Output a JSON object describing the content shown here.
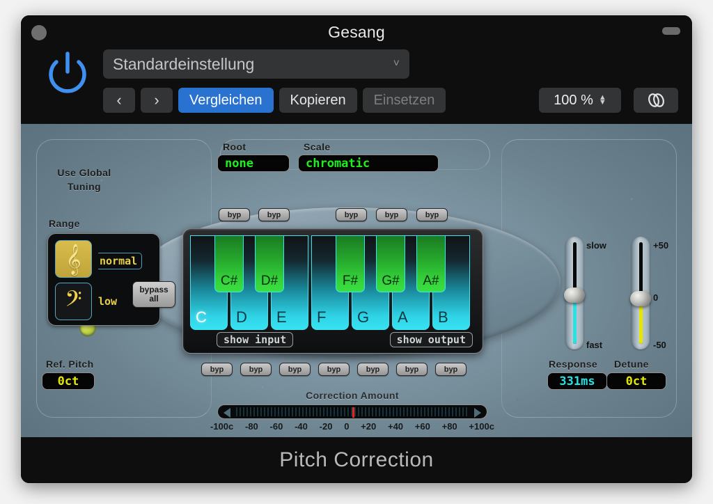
{
  "window": {
    "title": "Gesang",
    "footer_title": "Pitch Correction"
  },
  "header": {
    "power_icon": "power-icon",
    "preset": {
      "value": "Standardeinstellung",
      "chevron": "˅"
    },
    "prev_label": "‹",
    "next_label": "›",
    "compare_label": "Vergleichen",
    "copy_label": "Kopieren",
    "paste_label": "Einsetzen",
    "zoom_value": "100 %",
    "link_icon": "link-icon"
  },
  "left_panel": {
    "global_tuning_label_line1": "Use Global",
    "global_tuning_label_line2": "Tuning",
    "global_tuning_led_color": "#c5d94a",
    "range_label": "Range",
    "range_options": [
      {
        "glyph": "𝄞",
        "label": "normal",
        "selected": true
      },
      {
        "glyph": "𝄢",
        "label": "low",
        "selected": false
      }
    ],
    "ref_pitch_label": "Ref. Pitch",
    "ref_pitch_value": "0ct"
  },
  "scale_section": {
    "root_label": "Root",
    "root_value": "none",
    "scale_label": "Scale",
    "scale_value": "chromatic"
  },
  "bypass_all_label_line1": "bypass",
  "bypass_all_label_line2": "all",
  "byp_label": "byp",
  "byp_top": [
    "byp",
    "byp",
    "byp",
    "byp",
    "byp"
  ],
  "byp_bottom": [
    "byp",
    "byp",
    "byp",
    "byp",
    "byp",
    "byp",
    "byp"
  ],
  "keyboard": {
    "white_keys": [
      {
        "label": "C",
        "active": true
      },
      {
        "label": "D",
        "active": false
      },
      {
        "label": "E",
        "active": false
      },
      {
        "label": "F",
        "active": false
      },
      {
        "label": "G",
        "active": false
      },
      {
        "label": "A",
        "active": false
      },
      {
        "label": "B",
        "active": false
      }
    ],
    "black_keys": [
      {
        "label": "C#"
      },
      {
        "label": "D#"
      },
      {
        "label": "F#"
      },
      {
        "label": "G#"
      },
      {
        "label": "A#"
      }
    ],
    "show_input_label": "show input",
    "show_output_label": "show output"
  },
  "response": {
    "label": "Response",
    "value": "331ms",
    "top_tick": "slow",
    "bottom_tick": "fast",
    "color": "#2ae0e0",
    "knob_percent": 42
  },
  "detune": {
    "label": "Detune",
    "value": "0ct",
    "top_tick": "+50",
    "mid_tick": "0",
    "bottom_tick": "-50",
    "color": "#e4e800",
    "knob_percent": 50
  },
  "correction": {
    "label": "Correction Amount",
    "marker_color": "#e82222",
    "scale_ticks": [
      "-100c",
      "-80",
      "-60",
      "-40",
      "-20",
      "0",
      "+20",
      "+40",
      "+60",
      "+80",
      "+100c"
    ]
  }
}
